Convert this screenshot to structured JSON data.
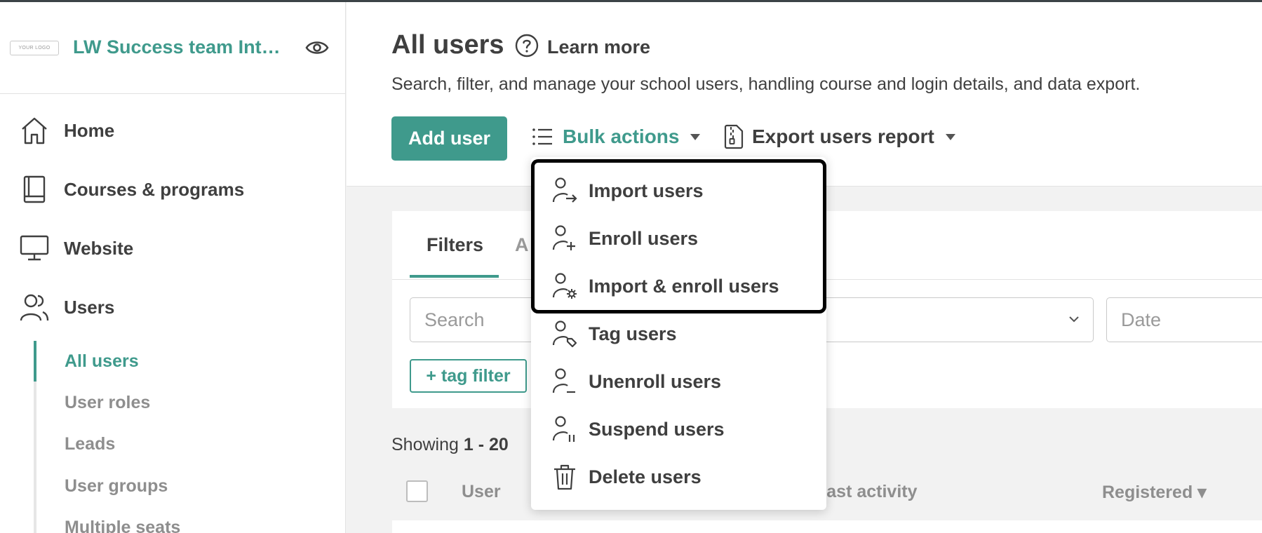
{
  "sidebar": {
    "logo_text": "YOUR LOGO",
    "school_name": "LW Success team Int…",
    "nav": [
      {
        "label": "Home",
        "icon": "home-icon"
      },
      {
        "label": "Courses & programs",
        "icon": "book-icon"
      },
      {
        "label": "Website",
        "icon": "monitor-icon"
      },
      {
        "label": "Users",
        "icon": "users-icon"
      }
    ],
    "subnav": [
      {
        "label": "All users",
        "active": true
      },
      {
        "label": "User roles"
      },
      {
        "label": "Leads"
      },
      {
        "label": "User groups"
      },
      {
        "label": "Multiple seats"
      }
    ]
  },
  "header": {
    "title": "All users",
    "learn_more": "Learn more",
    "subtitle": "Search, filter, and manage your school users, handling course and login details, and data export.",
    "add_user": "Add user",
    "bulk_actions": "Bulk actions",
    "export": "Export users report"
  },
  "filters": {
    "tab_filters": "Filters",
    "tab_other": "A",
    "search_placeholder": "Search",
    "date_placeholder": "Date",
    "tag_filter": "+ tag filter"
  },
  "list": {
    "showing_prefix": "Showing ",
    "showing_range": "1 - 20",
    "columns": {
      "user": "User",
      "last_activity": "Last activity",
      "registered": "Registered ▾"
    }
  },
  "bulk_menu": [
    {
      "label": "Import users",
      "icon": "user-import-icon"
    },
    {
      "label": "Enroll users",
      "icon": "user-add-icon"
    },
    {
      "label": "Import & enroll users",
      "icon": "user-settings-icon"
    },
    {
      "label": "Tag users",
      "icon": "user-tag-icon"
    },
    {
      "label": "Unenroll users",
      "icon": "user-remove-icon"
    },
    {
      "label": "Suspend users",
      "icon": "user-pause-icon"
    },
    {
      "label": "Delete users",
      "icon": "trash-icon"
    }
  ],
  "colors": {
    "accent": "#3f9a8c",
    "text": "#3f3f3f",
    "muted": "#8e8e8e"
  }
}
